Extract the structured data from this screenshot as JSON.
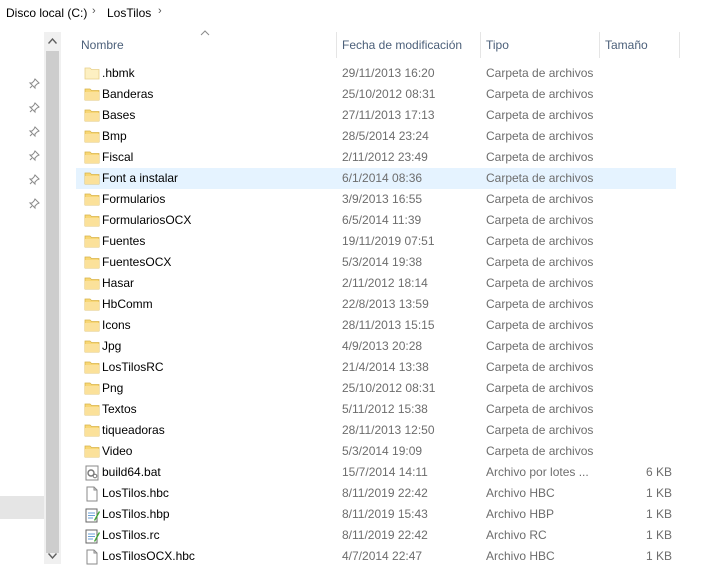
{
  "breadcrumb": {
    "items": [
      "Disco local (C:)",
      "LosTilos"
    ],
    "separator": "›"
  },
  "columns": {
    "name": "Nombre",
    "date": "Fecha de modificación",
    "type": "Tipo",
    "size": "Tamaño"
  },
  "colors": {
    "folder": "#f8d775",
    "selected_row": "#e5f3ff",
    "header_text": "#4c607a"
  },
  "files": [
    {
      "name": ".hbmk",
      "date": "29/11/2013 16:20",
      "type": "Carpeta de archivos",
      "size": "",
      "icon": "folder-empty-icon"
    },
    {
      "name": "Banderas",
      "date": "25/10/2012 08:31",
      "type": "Carpeta de archivos",
      "size": "",
      "icon": "folder-icon"
    },
    {
      "name": "Bases",
      "date": "27/11/2013 17:13",
      "type": "Carpeta de archivos",
      "size": "",
      "icon": "folder-icon"
    },
    {
      "name": "Bmp",
      "date": "28/5/2014 23:24",
      "type": "Carpeta de archivos",
      "size": "",
      "icon": "folder-icon"
    },
    {
      "name": "Fiscal",
      "date": "2/11/2012 23:49",
      "type": "Carpeta de archivos",
      "size": "",
      "icon": "folder-icon"
    },
    {
      "name": "Font a instalar",
      "date": "6/1/2014 08:36",
      "type": "Carpeta de archivos",
      "size": "",
      "icon": "folder-icon",
      "selected": true
    },
    {
      "name": "Formularios",
      "date": "3/9/2013 16:55",
      "type": "Carpeta de archivos",
      "size": "",
      "icon": "folder-icon"
    },
    {
      "name": "FormulariosOCX",
      "date": "6/5/2014 11:39",
      "type": "Carpeta de archivos",
      "size": "",
      "icon": "folder-icon"
    },
    {
      "name": "Fuentes",
      "date": "19/11/2019 07:51",
      "type": "Carpeta de archivos",
      "size": "",
      "icon": "folder-icon"
    },
    {
      "name": "FuentesOCX",
      "date": "5/3/2014 19:38",
      "type": "Carpeta de archivos",
      "size": "",
      "icon": "folder-icon"
    },
    {
      "name": "Hasar",
      "date": "2/11/2012 18:14",
      "type": "Carpeta de archivos",
      "size": "",
      "icon": "folder-icon"
    },
    {
      "name": "HbComm",
      "date": "22/8/2013 13:59",
      "type": "Carpeta de archivos",
      "size": "",
      "icon": "folder-icon"
    },
    {
      "name": "Icons",
      "date": "28/11/2013 15:15",
      "type": "Carpeta de archivos",
      "size": "",
      "icon": "folder-icon"
    },
    {
      "name": "Jpg",
      "date": "4/9/2013 20:28",
      "type": "Carpeta de archivos",
      "size": "",
      "icon": "folder-icon"
    },
    {
      "name": "LosTilosRC",
      "date": "21/4/2014 13:38",
      "type": "Carpeta de archivos",
      "size": "",
      "icon": "folder-icon"
    },
    {
      "name": "Png",
      "date": "25/10/2012 08:31",
      "type": "Carpeta de archivos",
      "size": "",
      "icon": "folder-icon"
    },
    {
      "name": "Textos",
      "date": "5/11/2012 15:38",
      "type": "Carpeta de archivos",
      "size": "",
      "icon": "folder-icon"
    },
    {
      "name": "tiqueadoras",
      "date": "28/11/2013 12:50",
      "type": "Carpeta de archivos",
      "size": "",
      "icon": "folder-icon"
    },
    {
      "name": "Video",
      "date": "5/3/2014 19:09",
      "type": "Carpeta de archivos",
      "size": "",
      "icon": "folder-icon"
    },
    {
      "name": "build64.bat",
      "date": "15/7/2014 14:11",
      "type": "Archivo por lotes ...",
      "size": "6 KB",
      "icon": "batch-file-icon"
    },
    {
      "name": "LosTilos.hbc",
      "date": "8/11/2019 22:42",
      "type": "Archivo HBC",
      "size": "1 KB",
      "icon": "document-file-icon"
    },
    {
      "name": "LosTilos.hbp",
      "date": "8/11/2019 15:43",
      "type": "Archivo HBP",
      "size": "1 KB",
      "icon": "notepad-file-icon"
    },
    {
      "name": "LosTilos.rc",
      "date": "8/11/2019 22:42",
      "type": "Archivo RC",
      "size": "1 KB",
      "icon": "notepad-file-icon"
    },
    {
      "name": "LosTilosOCX.hbc",
      "date": "4/7/2014 22:47",
      "type": "Archivo HBC",
      "size": "1 KB",
      "icon": "document-file-icon"
    }
  ]
}
